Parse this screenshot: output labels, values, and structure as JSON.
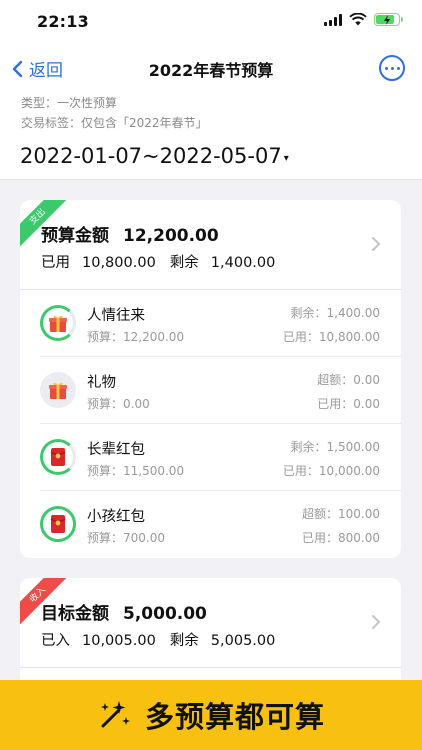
{
  "status": {
    "time": "22:13"
  },
  "nav": {
    "back_label": "返回",
    "title": "2022年春节预算"
  },
  "meta": {
    "type_line": "类型：一次性预算",
    "tag_line": "交易标签：仅包含「2022年春节」"
  },
  "date_range": "2022-01-07~2022-05-07",
  "budget_card": {
    "ribbon": "支出",
    "title_label": "预算金额",
    "title_value": "12,200.00",
    "used_label": "已用",
    "used_value": "10,800.00",
    "remaining_label": "剩余",
    "remaining_value": "1,400.00",
    "categories": [
      {
        "name": "人情往来",
        "budget": "预算：12,200.00",
        "right1": "剩余：1,400.00",
        "right2": "已用：10,800.00",
        "icon": "gift-icon",
        "progress": 0.89
      },
      {
        "name": "礼物",
        "budget": "预算：0.00",
        "right1": "超额：0.00",
        "right2": "已用：0.00",
        "icon": "gift-icon",
        "progress": 0
      },
      {
        "name": "长辈红包",
        "budget": "预算：11,500.00",
        "right1": "剩余：1,500.00",
        "right2": "已用：10,000.00",
        "icon": "red-envelope-icon",
        "progress": 0.87
      },
      {
        "name": "小孩红包",
        "budget": "预算：700.00",
        "right1": "超额：100.00",
        "right2": "已用：800.00",
        "icon": "red-envelope-icon",
        "progress": 1
      }
    ]
  },
  "goal_card": {
    "ribbon": "收入",
    "title_label": "目标金额",
    "title_value": "5,000.00",
    "income_label": "已入",
    "income_value": "10,005.00",
    "remaining_label": "剩余",
    "remaining_value": "5,005.00"
  },
  "promo": {
    "text": "多预算都可算",
    "icon": "sparkles-icon"
  },
  "colors": {
    "accent": "#2f6fda",
    "expense_ribbon": "#3cc96b",
    "income_ribbon": "#ef4b47",
    "promo_bg": "#f8c111"
  }
}
